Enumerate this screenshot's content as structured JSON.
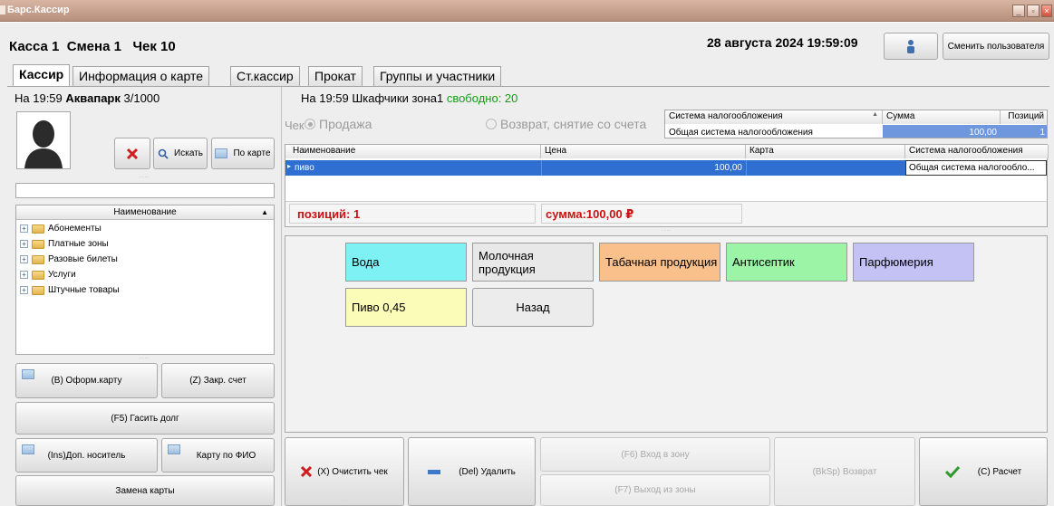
{
  "window": {
    "title": "Барс.Кассир",
    "min": "_",
    "max": "▫",
    "close": "×"
  },
  "header": {
    "kassa": "Касса 1",
    "smena": "Смена 1",
    "chek": "Чек 10",
    "datetime": "28 августа 2024 19:59:09",
    "change_user": "Сменить пользователя"
  },
  "tabs": [
    "Кассир",
    "Информация о карте",
    "Ст.кассир",
    "Прокат",
    "Группы и участники"
  ],
  "left": {
    "time_prefix": "На 19:59",
    "location": "Аквапарк",
    "capacity": "3/1000",
    "search_btn": "Искать",
    "bycard_btn": "По карте",
    "search_value": "",
    "tree_header": "Наименование",
    "tree": [
      "Абонементы",
      "Платные зоны",
      "Разовые билеты",
      "Услуги",
      "Штучные товары"
    ],
    "btn_card": "(B) Оформ.карту",
    "btn_close": "(Z) Закр. счет",
    "btn_debt": "(F5) Гасить долг",
    "btn_extra": "(Ins)Доп. носитель",
    "btn_byname": "Карту по ФИО",
    "btn_replace": "Замена карты"
  },
  "right": {
    "info": "На 19:59 Шкафчики зона1",
    "free": "свободно: 20",
    "chek_label": "Чек",
    "sale": "Продажа",
    "refund": "Возврат, снятие со счета",
    "tax_grid": {
      "headers": [
        "Система налогообложения",
        "Сумма",
        "Позиций"
      ],
      "row": [
        "Общая система налогообложения",
        "100,00",
        "1"
      ]
    },
    "items_grid": {
      "headers": [
        "Наименование",
        "Цена",
        "Карта",
        "Система налогообложения"
      ],
      "rows": [
        [
          "пиво",
          "100,00",
          "",
          "Общая система налогообло..."
        ]
      ]
    },
    "positions": "позиций: 1",
    "sum": "сумма:100,00 ₽"
  },
  "categories": [
    {
      "label": "Вода",
      "color": "#7ef1f5"
    },
    {
      "label": "Молочная продукция",
      "color": "#e8e8e8"
    },
    {
      "label": "Табачная продукция",
      "color": "#f9c08c"
    },
    {
      "label": "Антисептик",
      "color": "#9cf5a6"
    },
    {
      "label": "Парфюмерия",
      "color": "#c4c2f5"
    },
    {
      "label": "Пиво 0,45",
      "color": "#fbfcb8"
    },
    {
      "label": "Назад",
      "color": "#ececec"
    }
  ],
  "bottom": {
    "clear": "(X) Очистить чек",
    "delete": "(Del) Удалить",
    "enter_zone": "(F6) Вход в зону",
    "exit_zone": "(F7) Выход из зоны",
    "refund": "(BkSp) Возврат",
    "pay": "(C) Расчет"
  }
}
